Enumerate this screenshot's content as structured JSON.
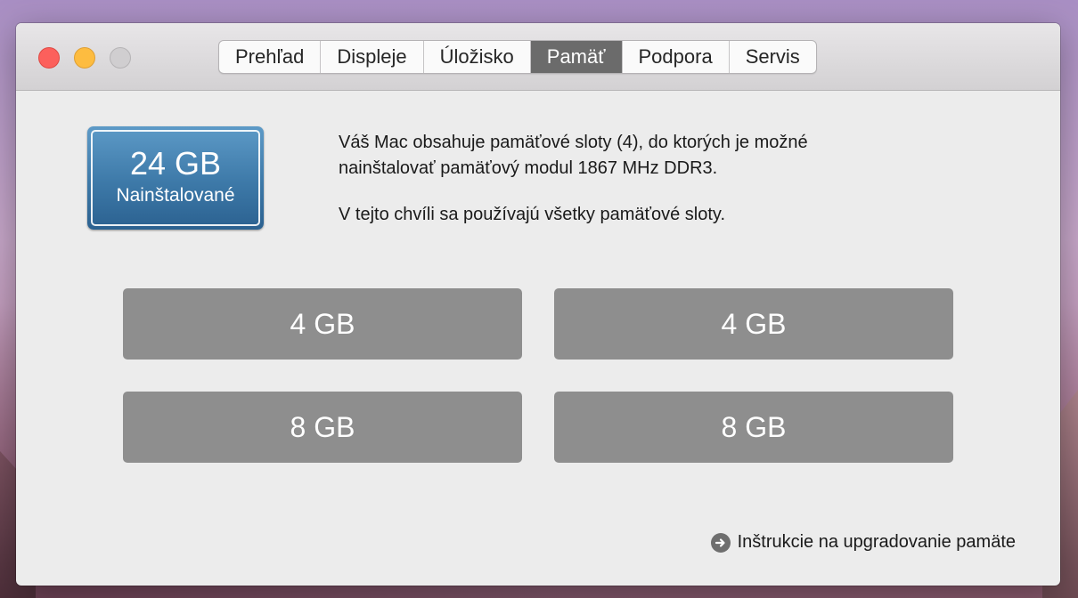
{
  "tabs": [
    {
      "label": "Prehľad",
      "active": false
    },
    {
      "label": "Displeje",
      "active": false
    },
    {
      "label": "Úložisko",
      "active": false
    },
    {
      "label": "Pamäť",
      "active": true
    },
    {
      "label": "Podpora",
      "active": false
    },
    {
      "label": "Servis",
      "active": false
    }
  ],
  "installed": {
    "size": "24 GB",
    "label": "Nainštalované"
  },
  "description": {
    "line1": "Váš Mac obsahuje pamäťové sloty (4), do ktorých je možné nainštalovať pamäťový modul 1867 MHz DDR3.",
    "line2": "V tejto chvíli sa používajú všetky pamäťové sloty."
  },
  "slots": [
    {
      "size": "4 GB"
    },
    {
      "size": "4 GB"
    },
    {
      "size": "8 GB"
    },
    {
      "size": "8 GB"
    }
  ],
  "upgrade_link": {
    "label": "Inštrukcie na upgradovanie pamäte",
    "icon": "arrow-right-circle-icon"
  },
  "colors": {
    "active_tab": "#6b6b6b",
    "badge_blue": "#3d79a8",
    "slot_gray": "#8e8e8e",
    "close": "#fc605c",
    "minimize": "#fdbc40"
  }
}
